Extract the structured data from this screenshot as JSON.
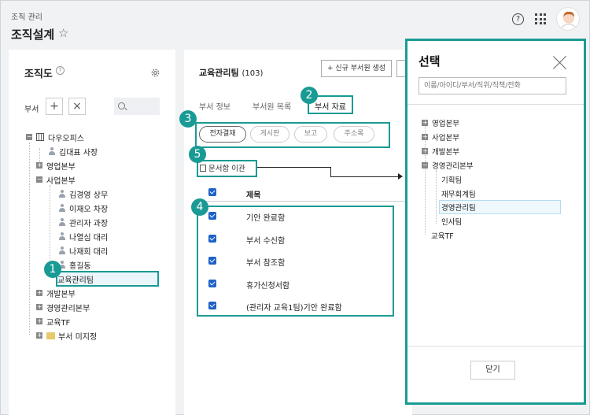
{
  "header": {
    "breadcrumb": "조직 관리",
    "title": "조직설계"
  },
  "left": {
    "title": "조직도",
    "dept_label": "부서",
    "tree": {
      "root": "다우오피스",
      "ceo": "김대표 사장",
      "sales": "영업본부",
      "biz": "사업본부",
      "biz_members": [
        "김경영 상무",
        "이재오 차장",
        "관리자 과장",
        "나열심 대리",
        "나재희 대리",
        "홍길동"
      ],
      "edu_team": "교육관리팀",
      "dev": "개발본부",
      "mgmt": "경영관리본부",
      "edu_tf": "교육TF",
      "unassigned": "부서 미지정"
    }
  },
  "middle": {
    "team_name": "교육관리팀",
    "team_count": "(103)",
    "new_dept_btn": "+ 신규 부서원 생성",
    "tabs": [
      "부서 정보",
      "부서원 목록",
      "부서 자료"
    ],
    "pills": [
      "전자결재",
      "게시판",
      "보고",
      "주소록"
    ],
    "move_btn": "문서함 이관",
    "col_title": "제목",
    "rows": [
      "기안 완료함",
      "부서 수신함",
      "부서 참조함",
      "휴가신청서함",
      "(관리자 교육1팀)기안 완료함"
    ]
  },
  "modal": {
    "title": "선택",
    "search_placeholder": "이름/아이디/부서/직위/직책/전화",
    "tree": {
      "sales": "영업본부",
      "biz": "사업본부",
      "dev": "개발본부",
      "mgmt": "경영관리본부",
      "mgmt_children": [
        "기획팀",
        "재무회계팀",
        "경영관리팀",
        "인사팀"
      ],
      "edu_tf": "교육TF"
    },
    "ok_label": "닫기"
  },
  "badges": [
    "1",
    "2",
    "3",
    "4",
    "5"
  ],
  "colors": {
    "accent": "#1a9a94",
    "checkbox": "#1f62c8"
  }
}
